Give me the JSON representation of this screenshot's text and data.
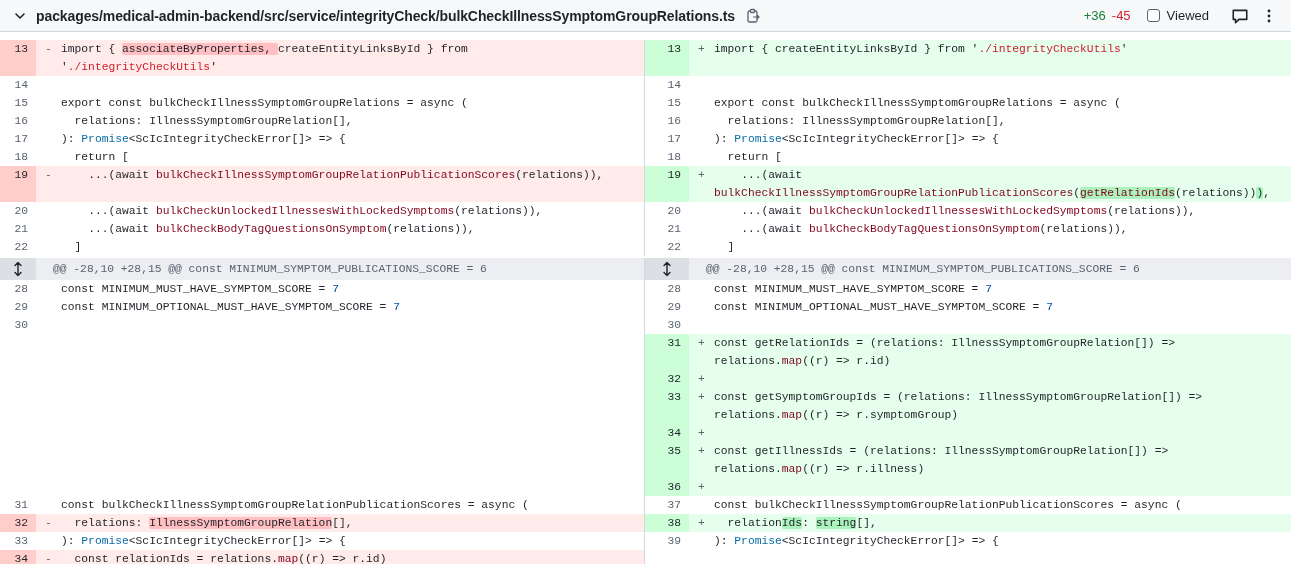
{
  "file_header": {
    "path": "packages/medical-admin-backend/src/service/integrityCheck/bulkCheckIllnessSymptomGroupRelations.ts",
    "additions": "+36",
    "deletions": "-45",
    "viewed": {
      "label": "Viewed",
      "checked": false
    }
  },
  "rows": [
    {
      "kind": "line",
      "left": {
        "kind": "del",
        "number": "13",
        "marker": "-",
        "code": [
          {
            "kind": "plain",
            "text": "import { ",
            "changed": false
          },
          {
            "kind": "plain",
            "text": "associateByProperties, ",
            "changed": true
          },
          {
            "kind": "plain",
            "text": "createEntityLinksById } from '",
            "changed": false
          },
          {
            "kind": "str",
            "text": "./integrityCheckUtils",
            "changed": false
          },
          {
            "kind": "plain",
            "text": "'",
            "changed": false
          }
        ]
      },
      "right": {
        "kind": "add",
        "number": "13",
        "marker": "+",
        "code": [
          {
            "kind": "plain",
            "text": "import { createEntityLinksById } from '",
            "changed": false
          },
          {
            "kind": "str",
            "text": "./integrityCheckUtils",
            "changed": false
          },
          {
            "kind": "plain",
            "text": "'",
            "changed": false
          }
        ]
      }
    },
    {
      "kind": "line",
      "left": {
        "kind": "context",
        "number": "14"
      },
      "right": {
        "kind": "context",
        "number": "14"
      }
    },
    {
      "kind": "line",
      "left": {
        "kind": "context",
        "number": "15",
        "code": [
          {
            "kind": "plain",
            "text": "export const bulkCheckIllnessSymptomGroupRelations = async ("
          }
        ]
      },
      "right": {
        "kind": "context",
        "number": "15",
        "code": [
          {
            "kind": "plain",
            "text": "export const bulkCheckIllnessSymptomGroupRelations = async ("
          }
        ]
      }
    },
    {
      "kind": "line",
      "left": {
        "kind": "context",
        "number": "16",
        "code": [
          {
            "kind": "plain",
            "text": "  relations: IllnessSymptomGroupRelation[],"
          }
        ]
      },
      "right": {
        "kind": "context",
        "number": "16",
        "code": [
          {
            "kind": "plain",
            "text": "  relations: IllnessSymptomGroupRelation[],"
          }
        ]
      }
    },
    {
      "kind": "line",
      "left": {
        "kind": "context",
        "number": "17",
        "code": [
          {
            "kind": "plain",
            "text": "): "
          },
          {
            "kind": "type",
            "text": "Promise"
          },
          {
            "kind": "plain",
            "text": "<ScIcIntegrityCheckError[]> => {"
          }
        ]
      },
      "right": {
        "kind": "context",
        "number": "17",
        "code": [
          {
            "kind": "plain",
            "text": "): "
          },
          {
            "kind": "type",
            "text": "Promise"
          },
          {
            "kind": "plain",
            "text": "<ScIcIntegrityCheckError[]> => {"
          }
        ]
      }
    },
    {
      "kind": "line",
      "left": {
        "kind": "context",
        "number": "18",
        "code": [
          {
            "kind": "plain",
            "text": "  return ["
          }
        ]
      },
      "right": {
        "kind": "context",
        "number": "18",
        "code": [
          {
            "kind": "plain",
            "text": "  return ["
          }
        ]
      }
    },
    {
      "kind": "line",
      "left": {
        "kind": "del",
        "number": "19",
        "marker": "-",
        "code": [
          {
            "kind": "plain",
            "text": "    ...(await ",
            "changed": false
          },
          {
            "kind": "fn",
            "text": "bulkCheckIllnessSymptomGroupRelationPublicationScores",
            "changed": false
          },
          {
            "kind": "plain",
            "text": "(relations)),",
            "changed": false
          }
        ]
      },
      "right": {
        "kind": "add",
        "number": "19",
        "marker": "+",
        "code": [
          {
            "kind": "plain",
            "text": "    ...(await ",
            "changed": false
          },
          {
            "kind": "fn",
            "text": "bulkCheckIllnessSymptomGroupRelationPublicationScores",
            "changed": false
          },
          {
            "kind": "plain",
            "text": "(",
            "changed": false
          },
          {
            "kind": "fn",
            "text": "getRelationIds",
            "changed": true
          },
          {
            "kind": "plain",
            "text": "(relations))",
            "changed": false
          },
          {
            "kind": "plain",
            "text": ")",
            "changed": true
          },
          {
            "kind": "plain",
            "text": ",",
            "changed": false
          }
        ]
      }
    },
    {
      "kind": "line",
      "left": {
        "kind": "context",
        "number": "20",
        "code": [
          {
            "kind": "plain",
            "text": "    ...(await "
          },
          {
            "kind": "fn",
            "text": "bulkCheckUnlockedIllnessesWithLockedSymptoms"
          },
          {
            "kind": "plain",
            "text": "(relations)),"
          }
        ]
      },
      "right": {
        "kind": "context",
        "number": "20",
        "code": [
          {
            "kind": "plain",
            "text": "    ...(await "
          },
          {
            "kind": "fn",
            "text": "bulkCheckUnlockedIllnessesWithLockedSymptoms"
          },
          {
            "kind": "plain",
            "text": "(relations)),"
          }
        ]
      }
    },
    {
      "kind": "line",
      "left": {
        "kind": "context",
        "number": "21",
        "code": [
          {
            "kind": "plain",
            "text": "    ...(await "
          },
          {
            "kind": "fn",
            "text": "bulkCheckBodyTagQuestionsOnSymptom"
          },
          {
            "kind": "plain",
            "text": "(relations)),"
          }
        ]
      },
      "right": {
        "kind": "context",
        "number": "21",
        "code": [
          {
            "kind": "plain",
            "text": "    ...(await "
          },
          {
            "kind": "fn",
            "text": "bulkCheckBodyTagQuestionsOnSymptom"
          },
          {
            "kind": "plain",
            "text": "(relations)),"
          }
        ]
      }
    },
    {
      "kind": "line",
      "left": {
        "kind": "context",
        "number": "22",
        "code": [
          {
            "kind": "plain",
            "text": "  ]"
          }
        ]
      },
      "right": {
        "kind": "context",
        "number": "22",
        "code": [
          {
            "kind": "plain",
            "text": "  ]"
          }
        ]
      }
    },
    {
      "kind": "hunk",
      "left": "@@ -28,10 +28,15 @@ const MINIMUM_SYMPTOM_PUBLICATIONS_SCORE = 6",
      "right": "@@ -28,10 +28,15 @@ const MINIMUM_SYMPTOM_PUBLICATIONS_SCORE = 6"
    },
    {
      "kind": "line",
      "left": {
        "kind": "context",
        "number": "28",
        "code": [
          {
            "kind": "plain",
            "text": "const MINIMUM_MUST_HAVE_SYMPTOM_SCORE = "
          },
          {
            "kind": "num",
            "text": "7"
          }
        ]
      },
      "right": {
        "kind": "context",
        "number": "28",
        "code": [
          {
            "kind": "plain",
            "text": "const MINIMUM_MUST_HAVE_SYMPTOM_SCORE = "
          },
          {
            "kind": "num",
            "text": "7"
          }
        ]
      }
    },
    {
      "kind": "line",
      "left": {
        "kind": "context",
        "number": "29",
        "code": [
          {
            "kind": "plain",
            "text": "const MINIMUM_OPTIONAL_MUST_HAVE_SYMPTOM_SCORE = "
          },
          {
            "kind": "num",
            "text": "7"
          }
        ]
      },
      "right": {
        "kind": "context",
        "number": "29",
        "code": [
          {
            "kind": "plain",
            "text": "const MINIMUM_OPTIONAL_MUST_HAVE_SYMPTOM_SCORE = "
          },
          {
            "kind": "num",
            "text": "7"
          }
        ]
      }
    },
    {
      "kind": "line",
      "left": {
        "kind": "context",
        "number": "30"
      },
      "right": {
        "kind": "context",
        "number": "30"
      }
    },
    {
      "kind": "line",
      "left": {
        "kind": "empty"
      },
      "right": {
        "kind": "add",
        "number": "31",
        "marker": "+",
        "code": [
          {
            "kind": "plain",
            "text": "const getRelationIds = (relations: IllnessSymptomGroupRelation[]) => relations.",
            "changed": false
          },
          {
            "kind": "fn",
            "text": "map",
            "changed": false
          },
          {
            "kind": "plain",
            "text": "((r) => r.id)",
            "changed": false
          }
        ]
      }
    },
    {
      "kind": "line",
      "left": {
        "kind": "empty"
      },
      "right": {
        "kind": "add",
        "number": "32",
        "marker": "+"
      }
    },
    {
      "kind": "line",
      "left": {
        "kind": "empty"
      },
      "right": {
        "kind": "add",
        "number": "33",
        "marker": "+",
        "code": [
          {
            "kind": "plain",
            "text": "const getSymptomGroupIds = (relations: IllnessSymptomGroupRelation[]) => relations.",
            "changed": false
          },
          {
            "kind": "fn",
            "text": "map",
            "changed": false
          },
          {
            "kind": "plain",
            "text": "((r) => r.symptomGroup)",
            "changed": false
          }
        ]
      }
    },
    {
      "kind": "line",
      "left": {
        "kind": "empty"
      },
      "right": {
        "kind": "add",
        "number": "34",
        "marker": "+"
      }
    },
    {
      "kind": "line",
      "left": {
        "kind": "empty"
      },
      "right": {
        "kind": "add",
        "number": "35",
        "marker": "+",
        "code": [
          {
            "kind": "plain",
            "text": "const getIllnessIds = (relations: IllnessSymptomGroupRelation[]) => relations.",
            "changed": false
          },
          {
            "kind": "fn",
            "text": "map",
            "changed": false
          },
          {
            "kind": "plain",
            "text": "((r) => r.illness)",
            "changed": false
          }
        ]
      }
    },
    {
      "kind": "line",
      "left": {
        "kind": "empty"
      },
      "right": {
        "kind": "add",
        "number": "36",
        "marker": "+"
      }
    },
    {
      "kind": "line",
      "left": {
        "kind": "context",
        "number": "31",
        "code": [
          {
            "kind": "plain",
            "text": "const bulkCheckIllnessSymptomGroupRelationPublicationScores = async ("
          }
        ]
      },
      "right": {
        "kind": "context",
        "number": "37",
        "code": [
          {
            "kind": "plain",
            "text": "const bulkCheckIllnessSymptomGroupRelationPublicationScores = async ("
          }
        ]
      }
    },
    {
      "kind": "line",
      "left": {
        "kind": "del",
        "number": "32",
        "marker": "-",
        "code": [
          {
            "kind": "plain",
            "text": "  relations: ",
            "changed": false
          },
          {
            "kind": "plain",
            "text": "IllnessSymptomGroupRelation",
            "changed": true
          },
          {
            "kind": "plain",
            "text": "[],",
            "changed": false
          }
        ]
      },
      "right": {
        "kind": "add",
        "number": "38",
        "marker": "+",
        "code": [
          {
            "kind": "plain",
            "text": "  relation",
            "changed": false
          },
          {
            "kind": "plain",
            "text": "Ids",
            "changed": true
          },
          {
            "kind": "plain",
            "text": ": ",
            "changed": false
          },
          {
            "kind": "plain",
            "text": "string",
            "changed": true
          },
          {
            "kind": "plain",
            "text": "[],",
            "changed": false
          }
        ]
      }
    },
    {
      "kind": "line",
      "left": {
        "kind": "context",
        "number": "33",
        "code": [
          {
            "kind": "plain",
            "text": "): "
          },
          {
            "kind": "type",
            "text": "Promise"
          },
          {
            "kind": "plain",
            "text": "<ScIcIntegrityCheckError[]> => {"
          }
        ]
      },
      "right": {
        "kind": "context",
        "number": "39",
        "code": [
          {
            "kind": "plain",
            "text": "): "
          },
          {
            "kind": "type",
            "text": "Promise"
          },
          {
            "kind": "plain",
            "text": "<ScIcIntegrityCheckError[]> => {"
          }
        ]
      }
    },
    {
      "kind": "line",
      "left": {
        "kind": "del",
        "number": "34",
        "marker": "-",
        "code": [
          {
            "kind": "plain",
            "text": "  const relationIds = relations.",
            "changed": false
          },
          {
            "kind": "fn",
            "text": "map",
            "changed": false
          },
          {
            "kind": "plain",
            "text": "((r) => r.id)",
            "changed": false
          }
        ]
      },
      "right": {
        "kind": "empty"
      }
    }
  ]
}
